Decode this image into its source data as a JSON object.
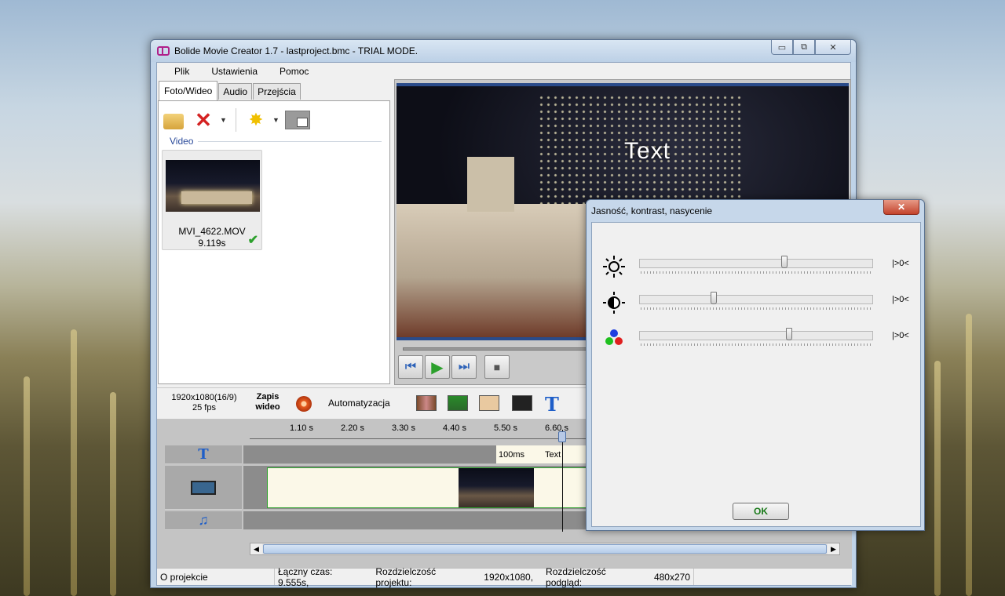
{
  "window": {
    "title": "Bolide Movie Creator 1.7 - lastproject.bmc  - TRIAL MODE.",
    "minimize_glyph": "▭",
    "maximize_glyph": "⧉",
    "close_glyph": "✕"
  },
  "menu": [
    "Plik",
    "Ustawienia",
    "Pomoc"
  ],
  "tabs": [
    "Foto/Wideo",
    "Audio",
    "Przejścia"
  ],
  "media": {
    "section_label": "Video",
    "items": [
      {
        "filename": "MVI_4622.MOV",
        "duration": "9.119s"
      }
    ]
  },
  "preview": {
    "overlay_text": "Text"
  },
  "toolbar": {
    "resolution": "1920x1080(16/9)",
    "fps": "25 fps",
    "record_label_line1": "Zapis",
    "record_label_line2": "wideo",
    "automation_label": "Automatyzacja"
  },
  "timeline": {
    "ticks": [
      "1.10 s",
      "2.20 s",
      "3.30 s",
      "4.40 s",
      "5.50 s",
      "6.60 s"
    ],
    "text_clip": {
      "duration": "100ms",
      "label": "Text"
    }
  },
  "status": {
    "about": "O projekcie",
    "total_time": "Łączny czas: 9.555s,",
    "project_res_label": "Rozdzielczość projektu:",
    "project_res": "1920x1080,",
    "preview_res_label": "Rozdzielczość podgląd:",
    "preview_res": "480x270"
  },
  "dialog": {
    "title": "Jasność, kontrast, nasycenie",
    "close_glyph": "✕",
    "rows": [
      {
        "icon": "brightness-icon",
        "value": "|>0<",
        "level": 0.62
      },
      {
        "icon": "contrast-icon",
        "value": "|>0<",
        "level": 0.32
      },
      {
        "icon": "saturation-icon",
        "value": "|>0<",
        "level": 0.64
      }
    ],
    "ok_label": "OK"
  }
}
